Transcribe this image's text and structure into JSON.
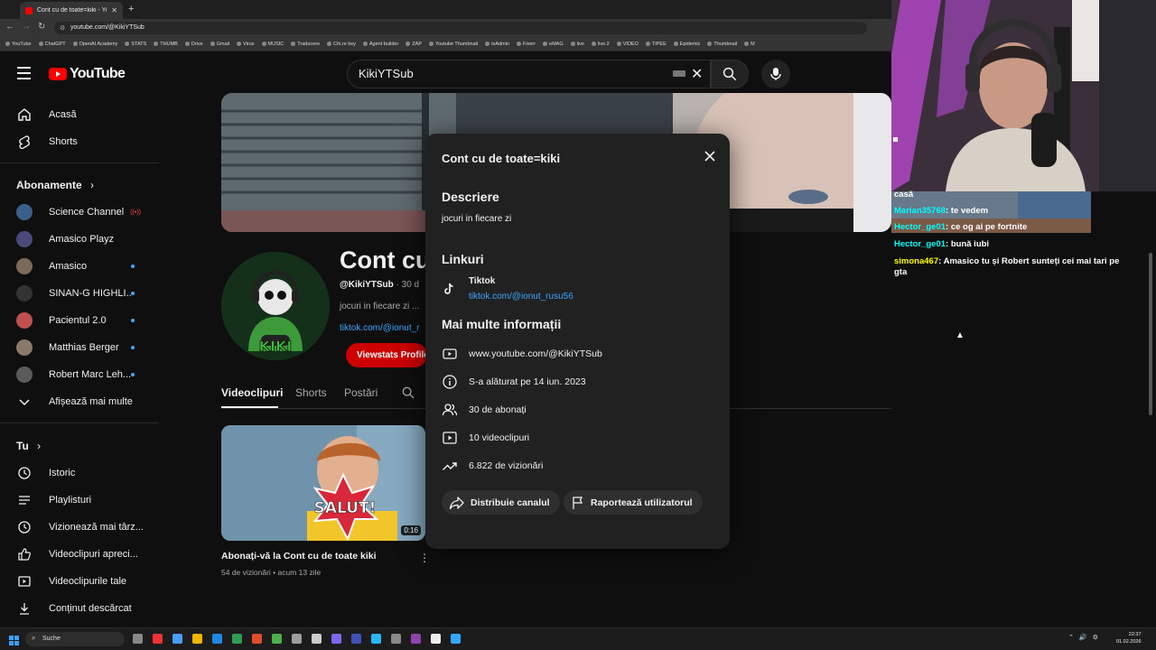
{
  "browser": {
    "tab_title": "Cont cu de toate=kiki - YouTube",
    "new_tab": "+",
    "url": "youtube.com/@KikiYTSub",
    "bookmarks": [
      "YouTube",
      "ChatGPT",
      "OpenAI Academy",
      "STATS",
      "THUMB",
      "Drive",
      "Gmail",
      "Virus",
      "MUSIC",
      "Traducere",
      "Cfx.re key",
      "Agent builder",
      "ZAP",
      "Youtube Thumbnail",
      "txAdmin",
      "Fiverr",
      "eMAG",
      "live",
      "live 2",
      "VIDEO",
      "TIPEE",
      "Epidemic",
      "Thumbnail",
      "M"
    ]
  },
  "youtube": {
    "logo": "YouTube",
    "search_value": "KikiYTSub"
  },
  "sidebar": {
    "main": [
      {
        "label": "Acasă",
        "icon": "home-icon"
      },
      {
        "label": "Shorts",
        "icon": "shorts-icon"
      }
    ],
    "subscriptions_header": "Abonamente",
    "subscriptions": [
      {
        "label": "Science Channel",
        "badge": "live",
        "color": "#3a5f8a"
      },
      {
        "label": "Amasico Playz",
        "badge": "",
        "color": "#4a4a7a"
      },
      {
        "label": "Amasico",
        "badge": "dot",
        "color": "#7a6a5a"
      },
      {
        "label": "SINAN-G HIGHLI...",
        "badge": "dot",
        "color": "#333333"
      },
      {
        "label": "Pacientul 2.0",
        "badge": "dot",
        "color": "#c05050"
      },
      {
        "label": "Matthias Berger",
        "badge": "dot",
        "color": "#8a7a6a"
      },
      {
        "label": "Robert Marc Leh...",
        "badge": "dot",
        "color": "#5a5a5a"
      }
    ],
    "show_more": "Afișează mai multe",
    "you_header": "Tu",
    "you_items": [
      {
        "label": "Istoric",
        "icon": "history-icon"
      },
      {
        "label": "Playlisturi",
        "icon": "playlist-icon"
      },
      {
        "label": "Vizionează mai târz...",
        "icon": "watch-later-icon"
      },
      {
        "label": "Videoclipuri apreci...",
        "icon": "like-icon"
      },
      {
        "label": "Videoclipurile tale",
        "icon": "your-videos-icon"
      },
      {
        "label": "Conținut descărcat",
        "icon": "download-icon"
      }
    ]
  },
  "channel": {
    "title": "Cont cu",
    "handle": "@KikiYTSub",
    "handle_suffix": "· 30 d",
    "description": "jocuri in fiecare zi ...",
    "link": "tiktok.com/@ionut_r",
    "action_button": "Viewstats Profile",
    "tabs": [
      "Videoclipuri",
      "Shorts",
      "Postări"
    ],
    "video": {
      "title": "Abonați-vă la Cont cu de toate kiki",
      "meta": "54 de vizionări • acum 13 zile",
      "duration": "0:16",
      "thumb_text": "SALUT!"
    }
  },
  "modal": {
    "title": "Cont cu de toate=kiki",
    "description_heading": "Descriere",
    "description": "jocuri in fiecare zi",
    "links_heading": "Linkuri",
    "link_name": "Tiktok",
    "link_url": "tiktok.com/@ionut_rusu56",
    "more_info_heading": "Mai multe informații",
    "info": [
      {
        "icon": "globe-icon",
        "text": "www.youtube.com/@KikiYTSub"
      },
      {
        "icon": "info-icon",
        "text": "S-a alăturat pe 14 iun. 2023"
      },
      {
        "icon": "subscribers-icon",
        "text": "30 de abonați"
      },
      {
        "icon": "videos-icon",
        "text": "10 videoclipuri"
      },
      {
        "icon": "trending-icon",
        "text": "6.822 de vizionări"
      }
    ],
    "share_button": "Distribuie canalul",
    "report_button": "Raportează utilizatorul"
  },
  "stream_chat": {
    "partial": "casă",
    "messages": [
      {
        "user": "Marian35768",
        "text": "te vedem",
        "color": "#00ffff"
      },
      {
        "user": "Hector_ge01",
        "text": "ce og ai pe fortnite",
        "color": "#00ffff"
      },
      {
        "user": "Hector_ge01",
        "text": "bună iubi",
        "color": "#00ffff"
      },
      {
        "user": "simona467",
        "text": "Amasico tu și Robert sunteți cei mai tari pe gta",
        "color": "#ffff00"
      }
    ]
  },
  "taskbar": {
    "search": "Suche",
    "time": "22:37",
    "date": "01.02.2026"
  }
}
